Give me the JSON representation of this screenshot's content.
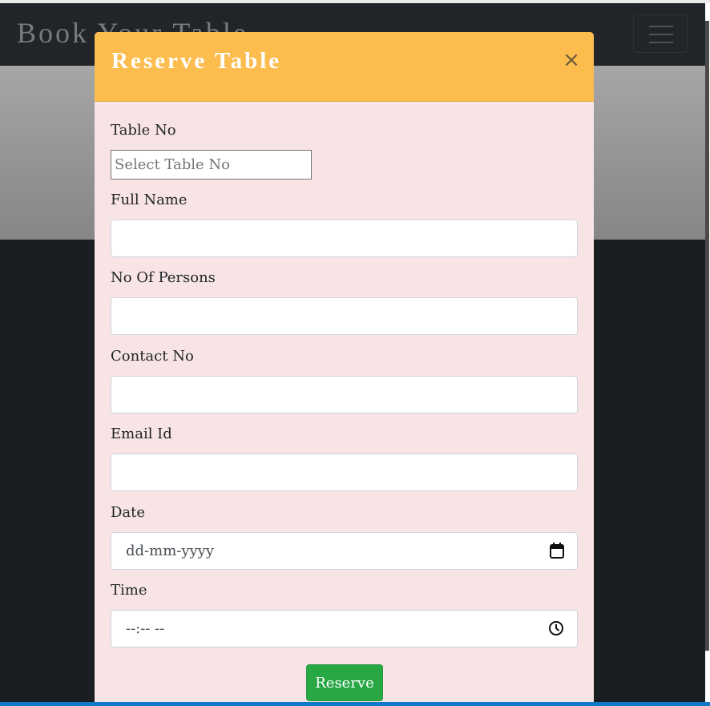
{
  "navbar": {
    "brand": "Book Your Table"
  },
  "modal": {
    "title": "Reserve Table",
    "close_glyph": "×",
    "fields": {
      "table_no": {
        "label": "Table No",
        "placeholder": "Select Table No"
      },
      "full_name": {
        "label": "Full Name",
        "value": ""
      },
      "persons": {
        "label": "No Of Persons",
        "value": ""
      },
      "contact": {
        "label": "Contact No",
        "value": ""
      },
      "email": {
        "label": "Email Id",
        "value": ""
      },
      "date": {
        "label": "Date",
        "placeholder": "dd-mm-yyyy",
        "icon": "calendar-icon"
      },
      "time": {
        "label": "Time",
        "placeholder": "--:-- --",
        "icon": "clock-icon"
      }
    },
    "submit_label": "Reserve"
  },
  "colors": {
    "modal_header": "#fdbd4e",
    "modal_body": "#f8e4e4",
    "submit": "#28a745",
    "navbar": "#212529"
  }
}
